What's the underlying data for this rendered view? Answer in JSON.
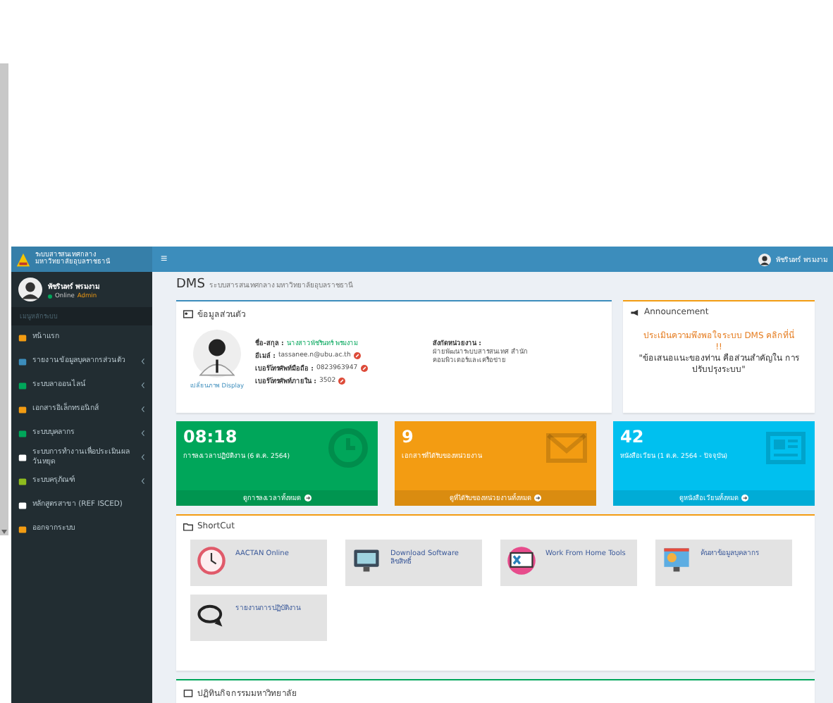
{
  "brand": {
    "line1": "ระบบสารสนเทศกลาง",
    "line2": "มหาวิทยาลัยอุบลราชธานี"
  },
  "user": {
    "name": "พัชรินทร์ พรมงาม",
    "status": "Online",
    "role": "Admin"
  },
  "sidebar": {
    "header": "เมนูหลักระบบ",
    "items": [
      {
        "label": "หน้าแรก",
        "color": "#f39c12",
        "submenu": false
      },
      {
        "label": "รายงานข้อมูลบุคลากรส่วนตัว",
        "color": "#3c8dbc",
        "submenu": true
      },
      {
        "label": "ระบบลาออนไลน์",
        "color": "#00a65a",
        "submenu": true
      },
      {
        "label": "เอกสารอิเล็กทรอนิกส์",
        "color": "#f39c12",
        "submenu": true
      },
      {
        "label": "ระบบบุคลากร",
        "color": "#00a65a",
        "submenu": true
      },
      {
        "label": "ระบบการทำงานเพื่อประเมินผล วันหยุด",
        "color": "#ffffff",
        "submenu": true
      },
      {
        "label": "ระบบครุภัณฑ์",
        "color": "#8fbc1e",
        "submenu": true
      },
      {
        "label": "หลักสูตรสาขา (REF ISCED)",
        "color": "#ffffff",
        "submenu": false
      },
      {
        "label": "ออกจากระบบ",
        "color": "#f39c12",
        "submenu": false
      }
    ]
  },
  "topbar": {
    "menu_glyph": "≡",
    "user": "พัชรินทร์ พรมงาม"
  },
  "page": {
    "title": "DMS",
    "subtitle": "ระบบสารสนเทศกลาง มหาวิทยาลัยอุบลราชธานี"
  },
  "profile": {
    "title": "ข้อมูลส่วนตัว",
    "change_photo": "เปลี่ยนภาพ Display",
    "fields": [
      {
        "label": "ชื่อ-สกุล :",
        "value": "นางสาวพัชรินทร์ พรมงาม",
        "editable": false
      },
      {
        "label": "อีเมล์ :",
        "value": "tassanee.n@ubu.ac.th",
        "editable": true
      },
      {
        "label": "เบอร์โทรศัพท์มือถือ :",
        "value": "0823963947",
        "editable": true
      },
      {
        "label": "เบอร์โทรศัพท์ภายใน :",
        "value": "3502",
        "editable": true
      }
    ],
    "unit_label": "สังกัดหน่วยงาน :",
    "unit_value": "ฝ่ายพัฒนาระบบสารสนเทศ สำนักคอมพิวเตอร์และเครือข่าย"
  },
  "announcement": {
    "title": "Announcement",
    "link": "ประเมินความพึงพอใจระบบ DMS คลิกที่นี่ !!",
    "quote": "\"ข้อเสนอแนะของท่าน คือส่วนสำคัญใน การปรับปรุงระบบ\""
  },
  "stats": [
    {
      "kind": "clock",
      "value": "08:18",
      "label": "การลงเวลาปฏิบัติงาน (6 ต.ค. 2564)",
      "footer": "ดูการลงเวลาทั้งหมด",
      "color": "#00a65a"
    },
    {
      "kind": "mail",
      "value": "9",
      "label": "เอกสารที่ได้รับของหน่วยงาน",
      "footer": "ดูที่ได้รับของหน่วยงานทั้งหมด",
      "color": "#f39c12"
    },
    {
      "kind": "news",
      "value": "42",
      "label": "หนังสือเวียน (1 ต.ค. 2564 - ปัจจุบัน)",
      "footer": "ดูหนังสือเวียนทั้งหมด",
      "color": "#00c0ef"
    }
  ],
  "shortcut": {
    "title": "ShortCut",
    "items": [
      {
        "kind": "clock",
        "label": "AACTAN Online"
      },
      {
        "kind": "monitor",
        "label": "Download Software ลิขสิทธิ์"
      },
      {
        "kind": "tools",
        "label": "Work From Home Tools"
      },
      {
        "kind": "person",
        "label": "ค้นหาข้อมูลบุคลากร"
      },
      {
        "kind": "chat",
        "label": "รายงานการปฏิบัติงาน"
      }
    ]
  },
  "bottom_panel": {
    "title": "ปฏิทินกิจกรรมมหาวิทยาลัย"
  }
}
